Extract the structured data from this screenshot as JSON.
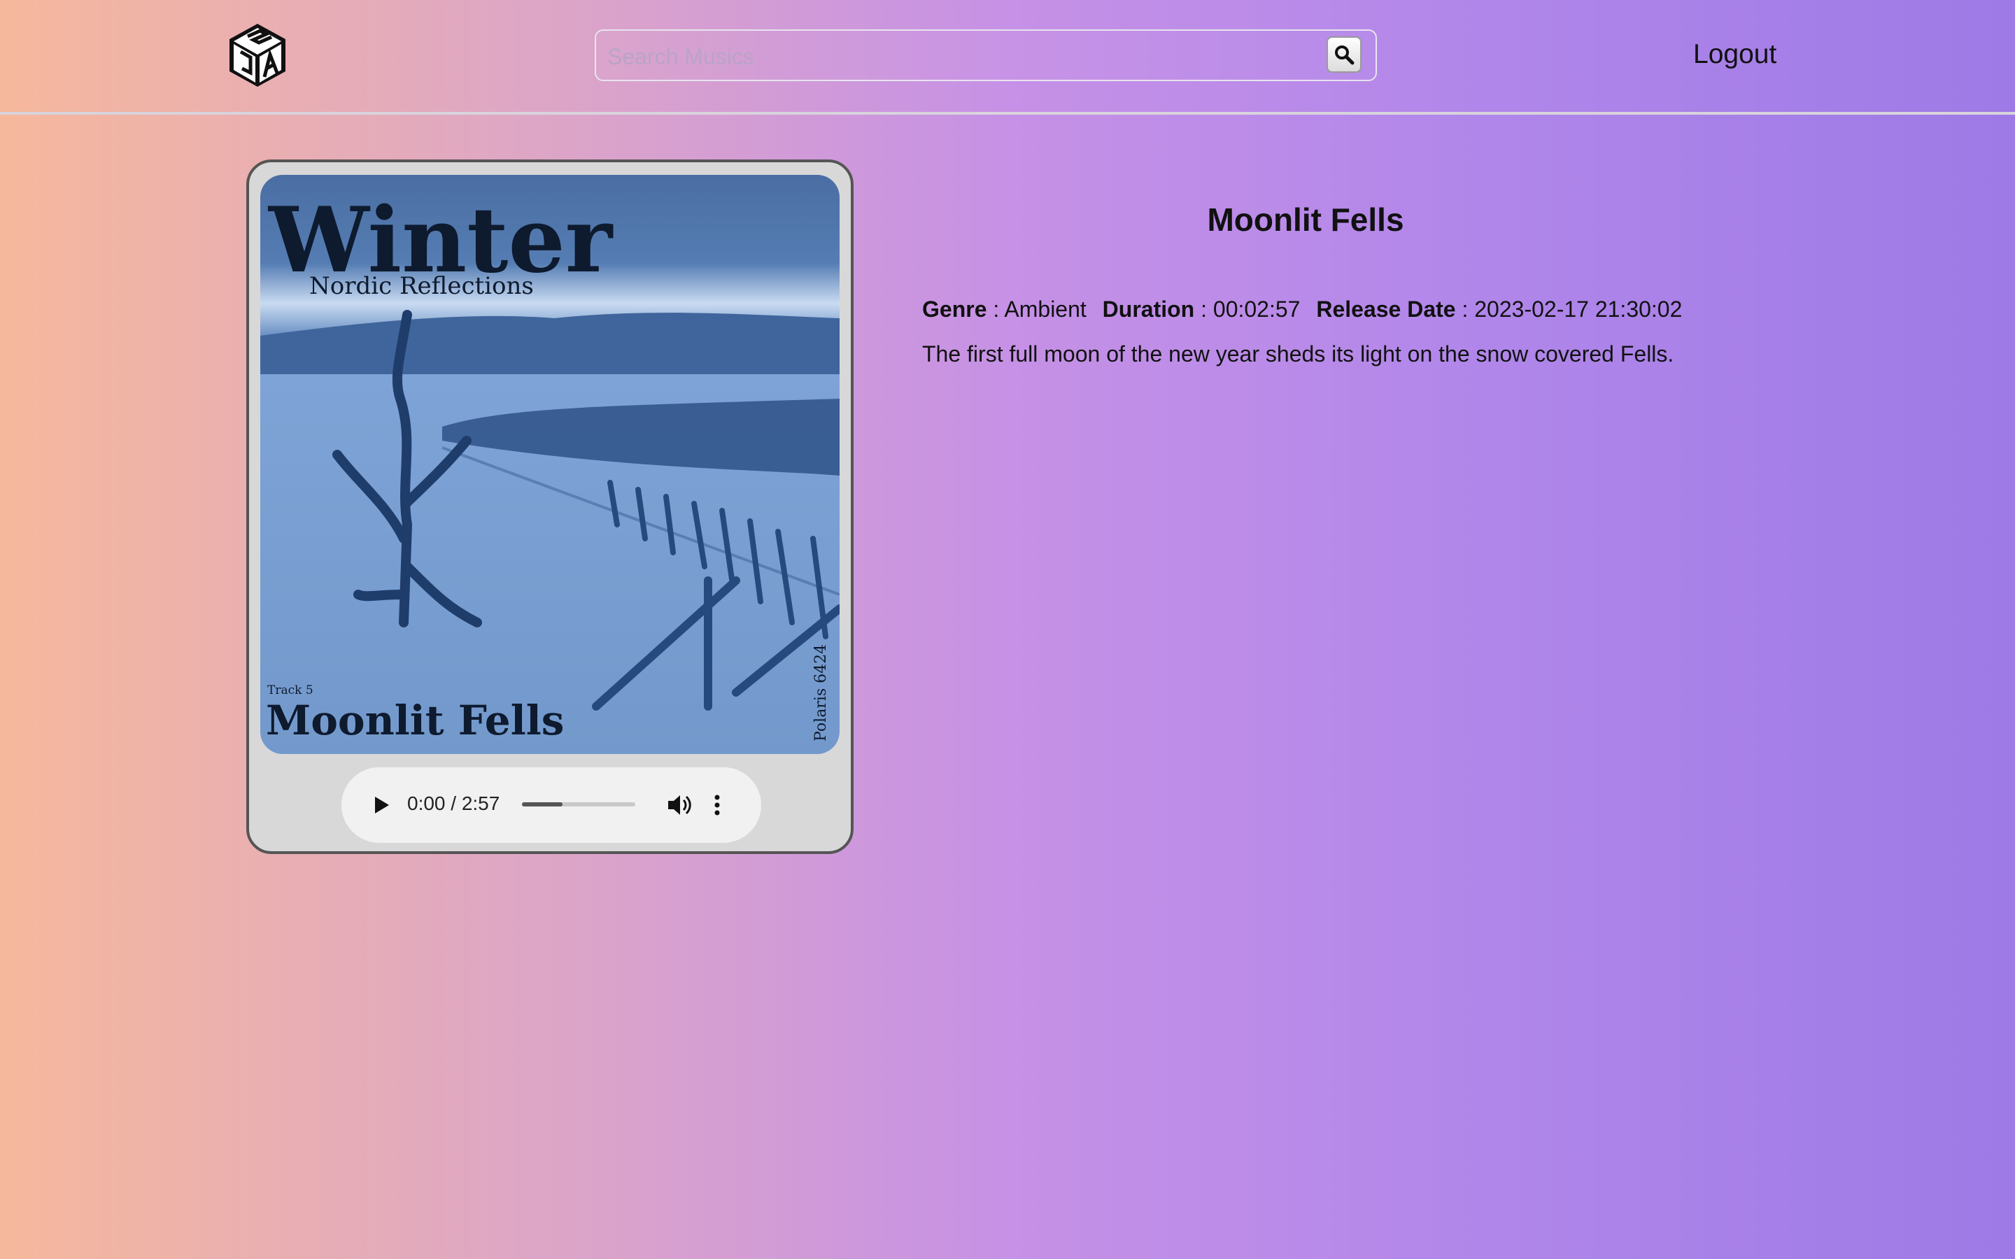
{
  "header": {
    "logo_alt": "JS cube logo",
    "search_placeholder": "Search Musics",
    "search_value": "",
    "logout_label": "Logout"
  },
  "track": {
    "title": "Moonlit Fells",
    "genre_label": "Genre",
    "genre": "Ambient",
    "duration_label": "Duration",
    "duration": "00:02:57",
    "release_label": "Release Date",
    "release_date": "2023-02-17 21:30:02",
    "description": "The first full moon of the new year sheds its light on the snow covered Fells.",
    "separator": ":"
  },
  "cover": {
    "headline": "Winter",
    "subtitle": "Nordic Reflections",
    "track_no": "Track 5",
    "track_name": "Moonlit Fells",
    "catalog": "Polaris 6424"
  },
  "player": {
    "time_display": "0:00 / 2:57",
    "progress_fraction": 0.36
  },
  "colors": {
    "gradient_start": "#f6b89c",
    "gradient_end": "#9d7ae6",
    "cover_blue": "#7399cc"
  },
  "icons": {
    "search": "search-icon",
    "play": "play-icon",
    "volume": "volume-icon",
    "more": "more-vertical-icon"
  }
}
